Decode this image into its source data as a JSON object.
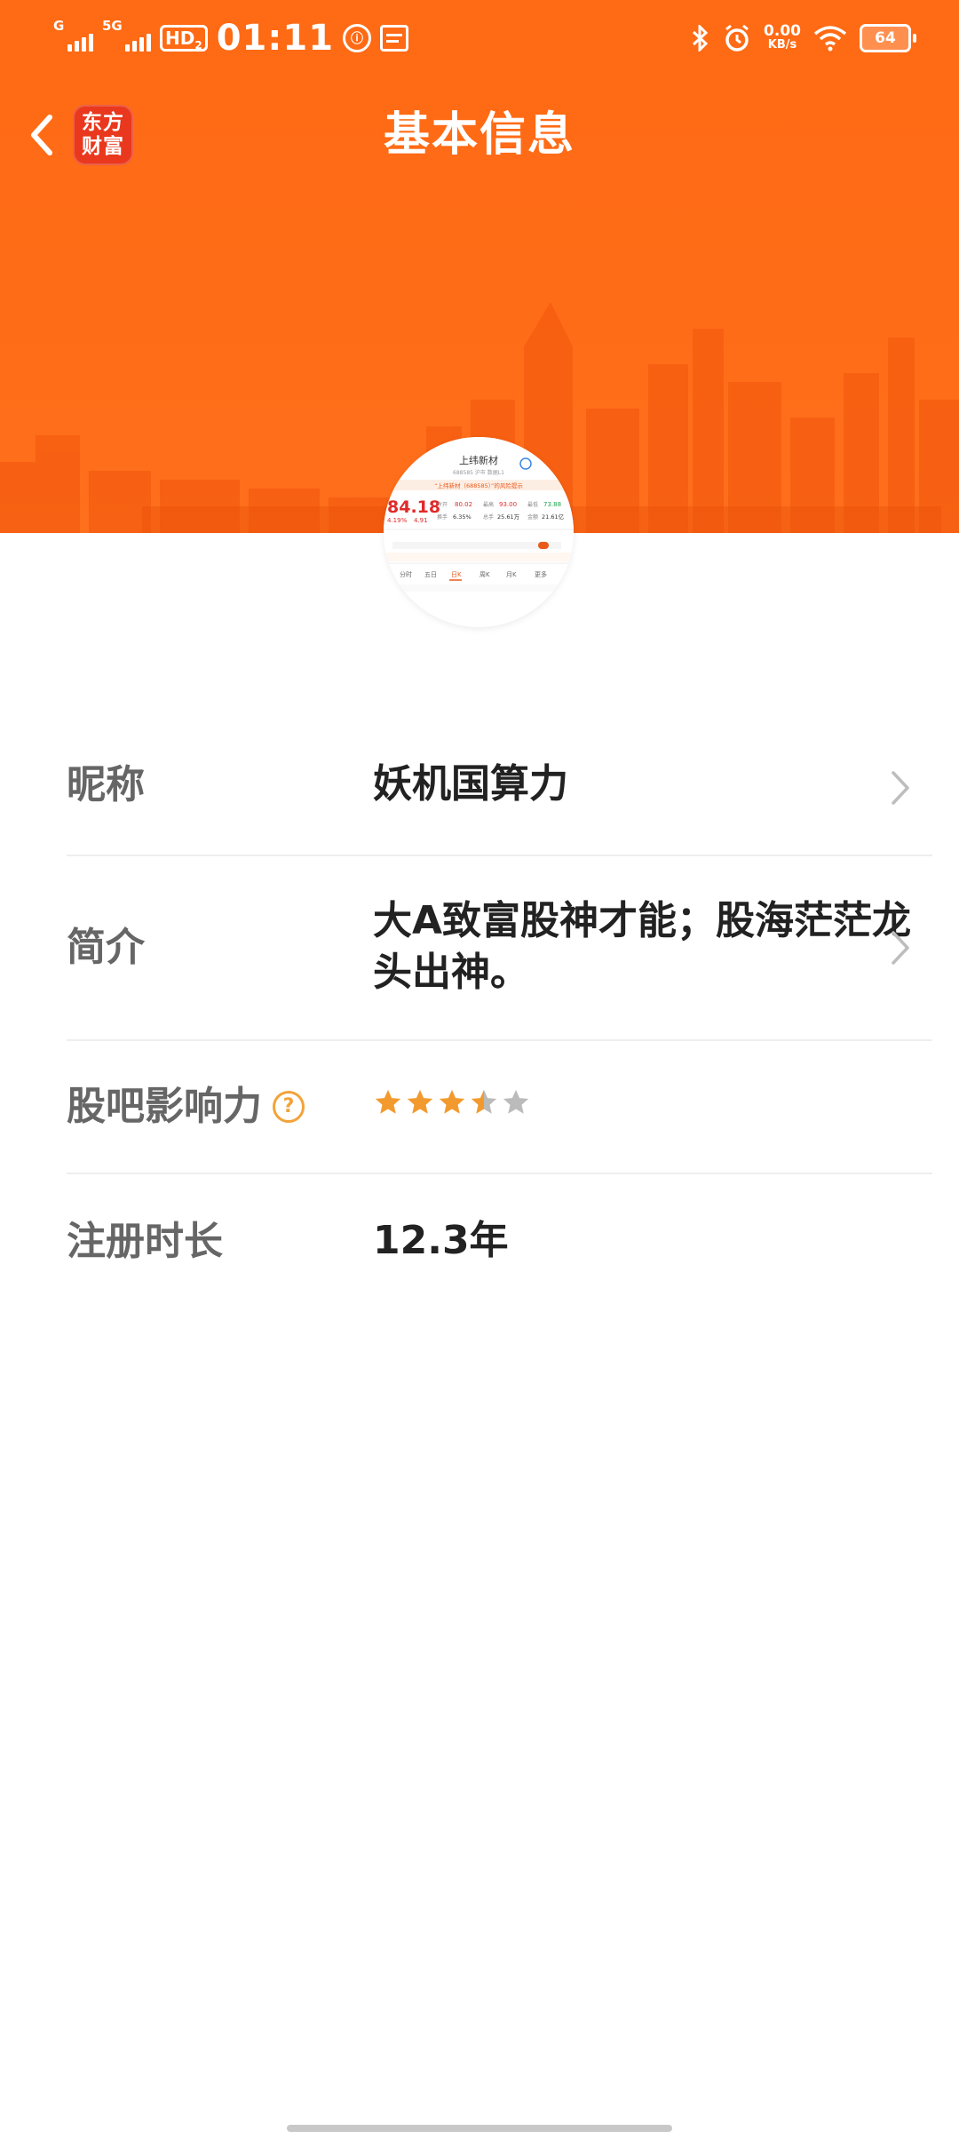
{
  "status_bar": {
    "sim1": "G",
    "sim2": "5G",
    "hd": "HD",
    "hd_sub": "2",
    "time": "01:11",
    "net_speed_value": "0.00",
    "net_speed_unit": "KB/s",
    "battery": "64"
  },
  "nav": {
    "title": "基本信息",
    "logo_line1": "东方",
    "logo_line2": "财富"
  },
  "profile": {
    "rows": [
      {
        "label": "昵称",
        "value": "妖机国算力"
      },
      {
        "label": "简介",
        "value": "大A致富股神才能；股海茫茫龙头出神。"
      },
      {
        "label": "股吧影响力",
        "rating": 3.5,
        "rating_max": 5
      },
      {
        "label": "注册时长",
        "value": "12.3年"
      }
    ]
  },
  "avatar_thumb": {
    "stock_name": "上纬新材",
    "code_line": "688585 沪市 数据L1",
    "notice": "“上纬新材（688585）”的风险提示",
    "price": "84.18",
    "pct": "4.19%",
    "chg": "4.91",
    "open_label": "今开",
    "open": "80.02",
    "high_label": "最高",
    "high": "93.00",
    "low_label": "最低",
    "low": "73.88",
    "turnover_label": "换手",
    "turnover": "6.35%",
    "volume_label": "总手",
    "volume": "25.61万",
    "amount_label": "金额",
    "amount": "21.61亿",
    "tabs": [
      "分时",
      "五日",
      "日K",
      "周K",
      "月K",
      "更多"
    ]
  },
  "colors": {
    "brand_orange": "#ff6a14",
    "logo_red": "#e9381d",
    "star_filled": "#f29a2e",
    "star_empty": "#bbbbbb",
    "help_icon": "#f2a33a"
  }
}
